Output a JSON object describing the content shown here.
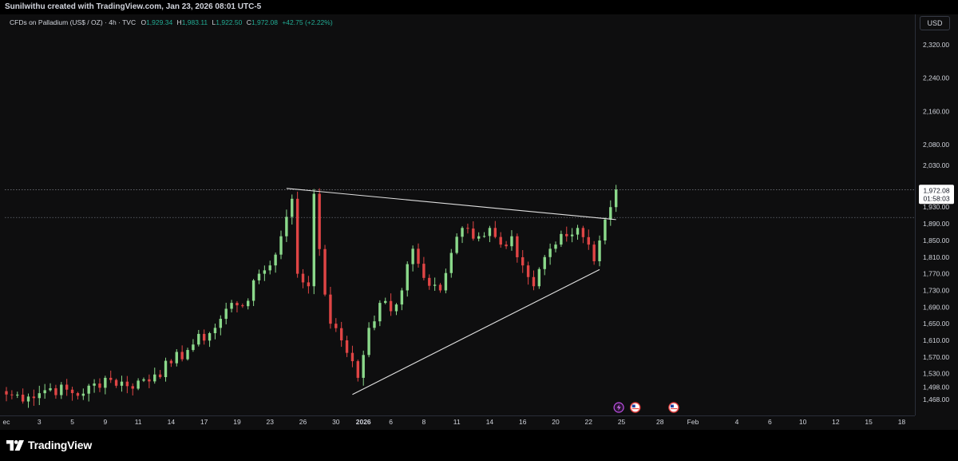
{
  "header": {
    "attribution": "Sunilwithu created with TradingView.com, Jan 23, 2026 08:01 UTC-5"
  },
  "legend": {
    "symbol": "CFDs on Palladium (US$ / OZ) · 4h · TVC",
    "open_label": "O",
    "open": "1,929.34",
    "high_label": "H",
    "high": "1,983.11",
    "low_label": "L",
    "low": "1,922.50",
    "close_label": "C",
    "close": "1,972.08",
    "change": "+42.75 (+2.22%)"
  },
  "currency": "USD",
  "price_tag": {
    "price": "1,972.08",
    "countdown": "01:58:03"
  },
  "footer": {
    "brand": "TradingView"
  },
  "colors": {
    "background": "#0e0e0f",
    "up": "#22ab94",
    "down": "#f23645",
    "up_bright": "#8bd98b",
    "down_bright": "#e04545",
    "trendline": "#e0e0e0",
    "text": "#d1d4dc"
  },
  "chart_data": {
    "type": "candlestick",
    "symbol": "CFDs on Palladium (US$ / OZ)",
    "timeframe": "4h",
    "ylim": [
      1445,
      2375
    ],
    "y_ticks": [
      "2,320.00",
      "2,240.00",
      "2,160.00",
      "2,080.00",
      "2,030.00",
      "1,930.00",
      "1,890.00",
      "1,850.00",
      "1,810.00",
      "1,770.00",
      "1,730.00",
      "1,690.00",
      "1,650.00",
      "1,610.00",
      "1,570.00",
      "1,530.00",
      "1,498.00",
      "1,468.00"
    ],
    "y_tick_values": [
      2320,
      2240,
      2160,
      2080,
      2030,
      1930,
      1890,
      1850,
      1810,
      1770,
      1730,
      1690,
      1650,
      1610,
      1570,
      1530,
      1498,
      1468
    ],
    "x_ticks": [
      "ec",
      "3",
      "5",
      "9",
      "11",
      "14",
      "17",
      "19",
      "23",
      "26",
      "30",
      "2026",
      "6",
      "8",
      "11",
      "14",
      "16",
      "20",
      "22",
      "25",
      "28",
      "Feb",
      "4",
      "6",
      "10",
      "12",
      "15",
      "18"
    ],
    "x_tick_index": [
      0,
      6,
      12,
      18,
      24,
      30,
      36,
      42,
      48,
      54,
      60,
      65,
      70,
      76,
      82,
      88,
      94,
      100,
      106,
      112,
      119,
      125,
      133,
      139,
      145,
      151,
      157,
      163
    ],
    "current_price": 1972.08,
    "reference_price": 1905,
    "anchors": [
      [
        0,
        1480
      ],
      [
        4,
        1475
      ],
      [
        8,
        1495
      ],
      [
        14,
        1482
      ],
      [
        18,
        1520
      ],
      [
        22,
        1500
      ],
      [
        27,
        1528
      ],
      [
        30,
        1555
      ],
      [
        34,
        1600
      ],
      [
        38,
        1640
      ],
      [
        41,
        1700
      ],
      [
        44,
        1705
      ],
      [
        46,
        1770
      ],
      [
        48,
        1790
      ],
      [
        50,
        1860
      ],
      [
        52,
        1950
      ],
      [
        53,
        1770
      ],
      [
        55,
        1740
      ],
      [
        56,
        1962
      ],
      [
        58,
        1720
      ],
      [
        59,
        1650
      ],
      [
        61,
        1610
      ],
      [
        63,
        1560
      ],
      [
        64,
        1520
      ],
      [
        66,
        1640
      ],
      [
        68,
        1700
      ],
      [
        70,
        1680
      ],
      [
        72,
        1730
      ],
      [
        74,
        1830
      ],
      [
        76,
        1760
      ],
      [
        79,
        1730
      ],
      [
        81,
        1820
      ],
      [
        83,
        1880
      ],
      [
        86,
        1860
      ],
      [
        88,
        1880
      ],
      [
        90,
        1840
      ],
      [
        92,
        1860
      ],
      [
        94,
        1790
      ],
      [
        96,
        1740
      ],
      [
        98,
        1810
      ],
      [
        100,
        1840
      ],
      [
        102,
        1860
      ],
      [
        104,
        1880
      ],
      [
        106,
        1840
      ],
      [
        107,
        1800
      ],
      [
        109,
        1900
      ],
      [
        110,
        1930
      ],
      [
        111,
        1972
      ]
    ],
    "trendlines": [
      {
        "from": [
          51,
          1975
        ],
        "to": [
          111,
          1900
        ]
      },
      {
        "from": [
          63,
          1480
        ],
        "to": [
          108,
          1780
        ]
      }
    ],
    "event_markers": [
      {
        "index": 111.5,
        "icon": "lightning-icon"
      },
      {
        "index": 114.5,
        "icon": "us-flag-icon"
      },
      {
        "index": 121.5,
        "icon": "us-flag-icon"
      }
    ]
  }
}
